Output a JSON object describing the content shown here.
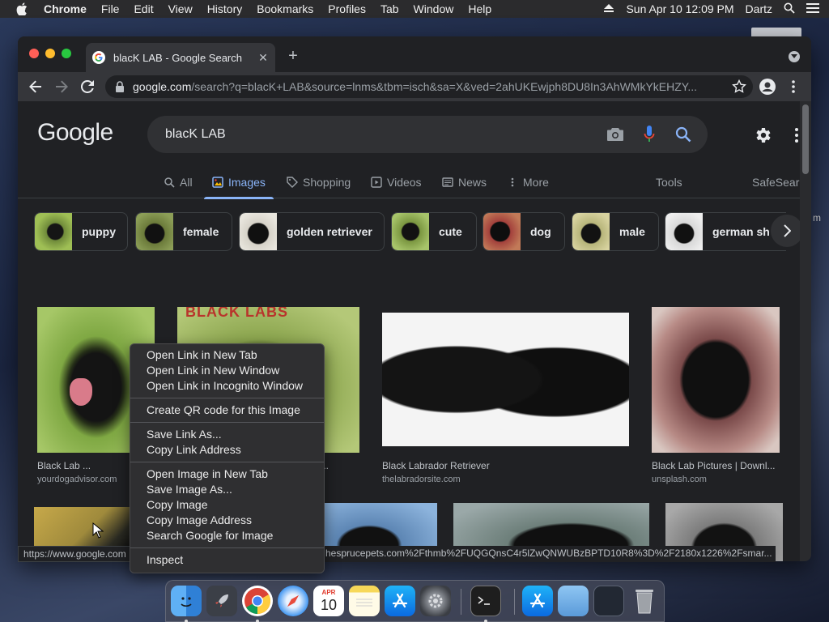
{
  "menubar": {
    "app": "Chrome",
    "items": [
      "File",
      "Edit",
      "View",
      "History",
      "Bookmarks",
      "Profiles",
      "Tab",
      "Window",
      "Help"
    ],
    "datetime": "Sun Apr 10  12:09 PM",
    "user": "Dartz"
  },
  "browser": {
    "tab_title": "blacK LAB - Google Search",
    "url_host": "google.com",
    "url_rest": "/search?q=blacK+LAB&source=lnms&tbm=isch&sa=X&ved=2ahUKEwjph8DU8In3AhWMkYkEHZY..."
  },
  "google": {
    "logo": "Google",
    "query": "blacK LAB",
    "tabs": [
      "All",
      "Images",
      "Shopping",
      "Videos",
      "News",
      "More"
    ],
    "tools": "Tools",
    "safesearch": "SafeSearch"
  },
  "chips": [
    "puppy",
    "female",
    "golden retriever",
    "cute",
    "dog",
    "male",
    "german sh"
  ],
  "results": [
    {
      "title": "Black Lab ...",
      "source": "yourdogadvisor.com"
    },
    {
      "title": "...",
      "source": ""
    },
    {
      "title": "Black Labrador Retriever",
      "source": "thelabradorsite.com"
    },
    {
      "title": "Black Lab Pictures | Downl...",
      "source": "unsplash.com"
    }
  ],
  "calendar_banner": "BLACK LABS",
  "status": {
    "left": "https://www.google.com",
    "right": "hesprucepets.com%2Fthmb%2FUQGQnsC4r5lZwQNWUBzBPTD10R8%3D%2F2180x1226%2Fsmar..."
  },
  "context_menu": {
    "group1": [
      "Open Link in New Tab",
      "Open Link in New Window",
      "Open Link in Incognito Window"
    ],
    "group2": [
      "Create QR code for this Image"
    ],
    "group3": [
      "Save Link As...",
      "Copy Link Address"
    ],
    "group4": [
      "Open Image in New Tab",
      "Save Image As...",
      "Copy Image",
      "Copy Image Address",
      "Search Google for Image"
    ],
    "group5": [
      "Inspect"
    ]
  },
  "dock": {
    "calendar_month": "APR",
    "calendar_day": "10"
  },
  "colors": {
    "bg": "#202124",
    "accent": "#8ab4f8",
    "menu_bg": "#2f2f31"
  }
}
